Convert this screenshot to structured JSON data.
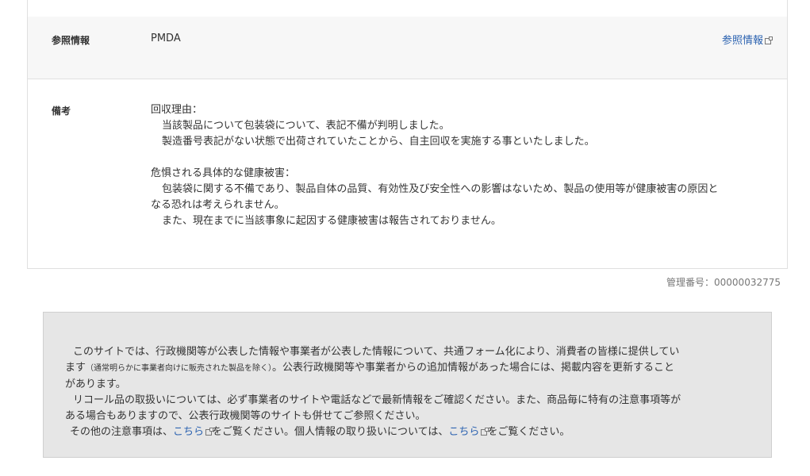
{
  "reference": {
    "label": "参照情報",
    "value": "PMDA",
    "link_text": "参照情報"
  },
  "notes": {
    "label": "備考",
    "reason_heading": "回収理由：",
    "reason_line1": "当該製品について包装袋について、表記不備が判明しました。",
    "reason_line2": "製造番号表記がない状態で出荷されていたことから、自主回収を実施する事といたしました。",
    "hazard_heading": "危惧される具体的な健康被害：",
    "hazard_line1": "包装袋に関する不備であり、製品自体の品質、有効性及び安全性への影響はないため、製品の使用等が健康被害の原因と",
    "hazard_line2": "なる恐れは考えられません。",
    "hazard_line3": "また、現在までに当該事象に起因する健康被害は報告されておりません。"
  },
  "management_number": "管理番号：00000032775",
  "footer": {
    "p1_line1": "このサイトでは、行政機関等が公表した情報や事業者が公表した情報について、共通フォーム化により、消費者の皆様に提供してい",
    "p1_line2_a": "ます",
    "p1_line2_small": "（通常明らかに事業者向けに販売された製品を除く）",
    "p1_line2_b": "。公表行政機関等や事業者からの追加情報があった場合には、掲載内容を更新すること",
    "p1_line3": "があります。",
    "p2_line1": "リコール品の取扱いについては、必ず事業者のサイトや電話などで最新情報をご確認ください。また、商品毎に特有の注意事項等が",
    "p2_line2": "ある場合もありますので、公表行政機関等のサイトも併せてご参照ください。",
    "p3_a": "その他の注意事項は、",
    "p3_link1": "こちら",
    "p3_b": "をご覧ください。個人情報の取り扱いについては、",
    "p3_link2": "こちら",
    "p3_c": "をご覧ください。"
  }
}
